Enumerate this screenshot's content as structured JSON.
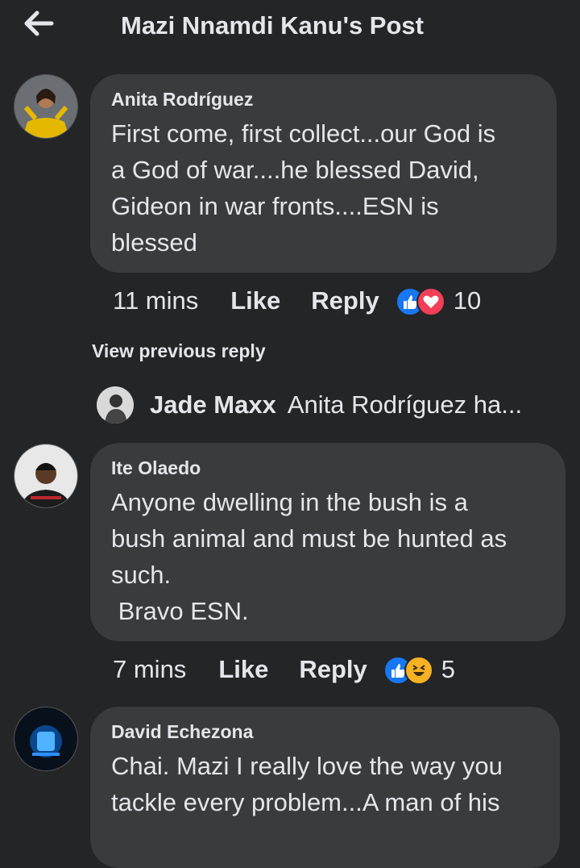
{
  "header": {
    "title": "Mazi Nnamdi Kanu's Post",
    "back_icon": "arrow-left-icon"
  },
  "comments": [
    {
      "author": "Anita Rodríguez",
      "text": "First come, first collect...our God is\na God of war....he blessed David,\nGideon in war fronts....ESN is\nblessed",
      "time": "11 mins",
      "like_label": "Like",
      "reply_label": "Reply",
      "reactions": [
        "like-icon",
        "love-icon"
      ],
      "reaction_count": "10"
    },
    {
      "author": "Ite Olaedo",
      "text": "Anyone dwelling in the bush is a\nbush animal and must be hunted as\nsuch.\n Bravo ESN.",
      "time": "7 mins",
      "like_label": "Like",
      "reply_label": "Reply",
      "reactions": [
        "like-icon",
        "haha-icon"
      ],
      "reaction_count": "5"
    },
    {
      "author": "David Echezona",
      "text": "Chai. Mazi I really love the way you\ntackle every problem...A man of his"
    }
  ],
  "view_previous": "View previous reply",
  "reply_preview": {
    "author": "Jade Maxx",
    "snippet": "Anita Rodríguez ha..."
  },
  "colors": {
    "background": "#242526",
    "bubble": "#3a3b3c",
    "text": "#e4e6eb",
    "like_blue": "#1877f2",
    "love_red": "#f33e58",
    "haha_yellow": "#f7b125"
  }
}
